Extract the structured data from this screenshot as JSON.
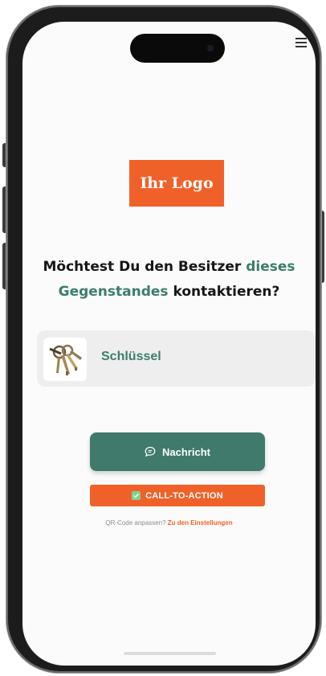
{
  "app": {
    "logo_text": "Ihr Logo",
    "headline": {
      "part1": "Möchtest Du den Besitzer ",
      "accent1": "dieses",
      "accent2": "Gegenstandes",
      "part2": " kontaktieren?"
    },
    "item": {
      "name": "Schlüssel",
      "thumbnail_icon": "keys-photo"
    },
    "actions": {
      "message_label": "Nachricht",
      "message_icon": "chat-bubble-icon",
      "cta_label": "CALL-TO-ACTION",
      "cta_icon": "checkbox-icon"
    },
    "footer": {
      "prompt": "QR-Code anpassen?",
      "link": "Zu den Einstellungen"
    },
    "menu_icon": "menu-icon"
  },
  "colors": {
    "brand_orange": "#f0612a",
    "brand_green": "#3f7a6c",
    "card_bg": "#eeeeee",
    "screen_bg": "#fbfbfb"
  }
}
